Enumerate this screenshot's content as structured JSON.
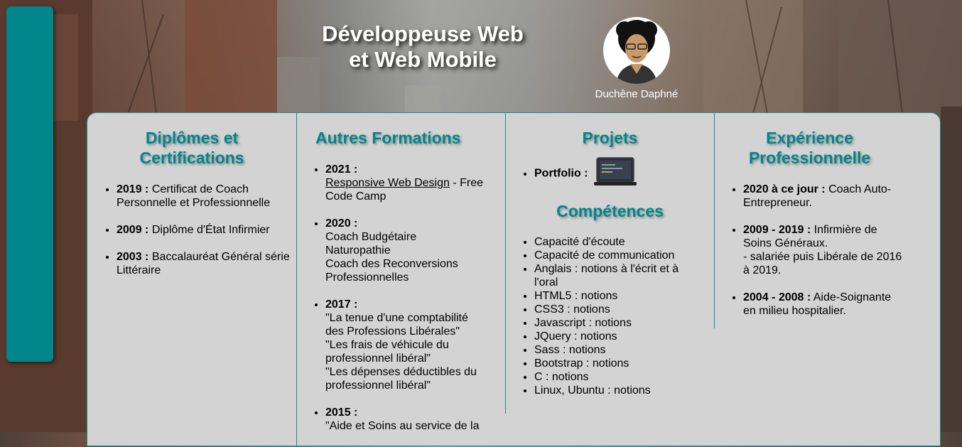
{
  "header": {
    "title_line1": "Développeuse Web",
    "title_line2": "et Web Mobile",
    "name": "Duchêne Daphné"
  },
  "diplomes": {
    "title_line1": "Diplômes et",
    "title_line2": "Certifications",
    "items": [
      {
        "year": "2019 :",
        "text": "Certificat de Coach Personnelle et Professionnelle"
      },
      {
        "year": "2009 :",
        "text": "Diplôme d'État Infirmier"
      },
      {
        "year": "2003 :",
        "text": "Baccalauréat Général série Littéraire"
      }
    ]
  },
  "formations": {
    "title": "Autres Formations",
    "items": [
      {
        "year": "2021 :",
        "link": "Responsive Web Design",
        "rest": " - Free Code Camp"
      },
      {
        "year": "2020 :",
        "lines": [
          "Coach Budgétaire",
          "Naturopathie",
          "Coach des Reconversions Professionnelles"
        ]
      },
      {
        "year": "2017 :",
        "lines": [
          "\"La tenue d'une comptabilité des Professions Libérales\"",
          "\"Les frais de véhicule du professionnel libéral\"",
          "\"Les dépenses déductibles du professionnel libéral\""
        ]
      },
      {
        "year": "2015 :",
        "lines": [
          "\"Aide et Soins au service de la"
        ]
      }
    ]
  },
  "projets": {
    "title": "Projets",
    "portfolio_label": "Portfolio :",
    "laptop_icon": "laptop-icon"
  },
  "competences": {
    "title": "Compétences",
    "items": [
      "Capacité d'écoute",
      "Capacité de communication",
      "Anglais : notions à l'écrit et à l'oral",
      "HTML5 : notions",
      "CSS3 : notions",
      "Javascript : notions",
      "JQuery : notions",
      "Sass : notions",
      "Bootstrap : notions",
      "C : notions",
      "Linux, Ubuntu : notions"
    ]
  },
  "experience": {
    "title_line1": "Expérience",
    "title_line2": "Professionnelle",
    "items": [
      {
        "year": "2020 à ce jour :",
        "text": "Coach Auto-Entrepreneur."
      },
      {
        "year": "2009 - 2019 :",
        "text": "Infirmière de Soins Généraux.",
        "extra": "- salariée puis Libérale de 2016 à 2019."
      },
      {
        "year": "2004 - 2008 :",
        "text": "Aide-Soignante en milieu hospitalier."
      }
    ]
  },
  "colors": {
    "accent": "#00868b",
    "panel": "#d3d3d3"
  }
}
